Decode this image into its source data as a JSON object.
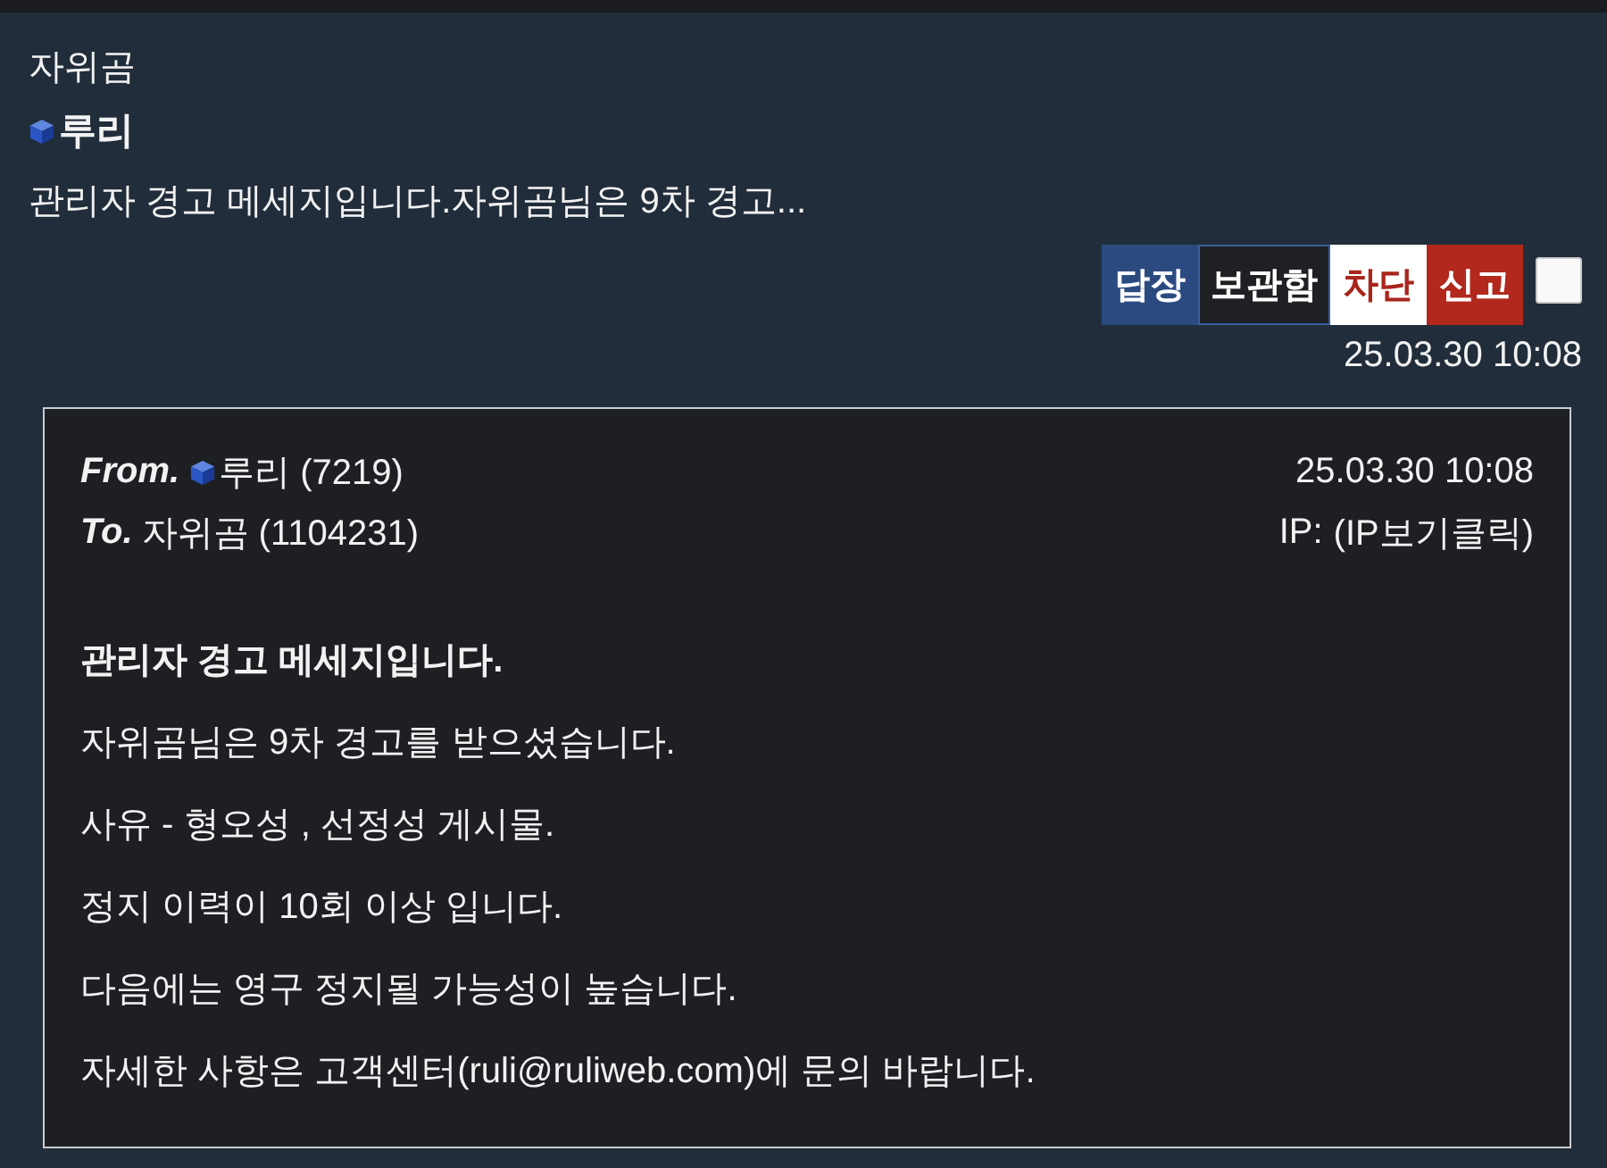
{
  "summary": {
    "name": "자위곰",
    "user": "루리",
    "preview": "관리자 경고 메세지입니다.자위곰님은 9차 경고..."
  },
  "actions": [
    {
      "label": "답장",
      "kind": "reply"
    },
    {
      "label": "보관함",
      "kind": "archive"
    },
    {
      "label": "차단",
      "kind": "block"
    },
    {
      "label": "신고",
      "kind": "report"
    }
  ],
  "select_checkbox": {
    "checked": false
  },
  "date": "25.03.30 10:08",
  "message": {
    "from_label": "From.",
    "from_user": "루리 (7219)",
    "to_label": "To.",
    "to_user": "자위곰 (1104231)",
    "date": "25.03.30 10:08",
    "ip_label": "IP:",
    "ip_link": "(IP보기클릭)",
    "title": "관리자 경고 메세지입니다.",
    "lines": [
      "자위곰님은 9차 경고를 받으셨습니다.",
      "사유 - 형오성 , 선정성 게시물.",
      "정지 이력이 10회 이상 입니다.",
      "다음에는 영구 정지될 가능성이 높습니다.",
      "자세한 사항은 고객센터(ruli@ruliweb.com)에 문의 바랍니다."
    ]
  }
}
